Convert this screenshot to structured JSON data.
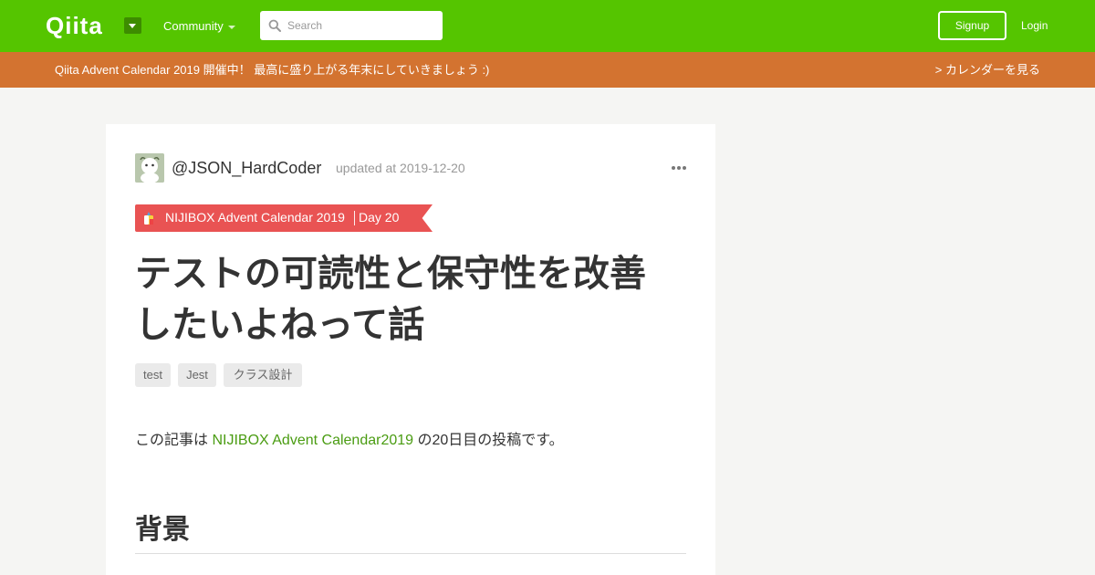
{
  "header": {
    "logo": "Qiita",
    "community_label": "Community",
    "search_placeholder": "Search",
    "signup_label": "Signup",
    "login_label": "Login"
  },
  "banner": {
    "text": "Qiita Advent Calendar 2019 開催中！ 最高に盛り上がる年末にしていきましょう :)",
    "link": "> カレンダーを見る"
  },
  "article": {
    "author": "@JSON_HardCoder",
    "updated": "updated at 2019-12-20",
    "calendar_name": "NIJIBOX Advent Calendar 2019",
    "calendar_day": "Day 20",
    "title_line1": "テストの可読性と保守性を改善",
    "title_line2": "したいよねって話",
    "tags": [
      "test",
      "Jest",
      "クラス設計"
    ],
    "intro_prefix": "この記事は ",
    "intro_link": "NIJIBOX Advent Calendar2019",
    "intro_suffix": " の20日目の投稿です。",
    "section_heading": "背景"
  },
  "colors": {
    "header_bg": "#55c500",
    "banner_bg": "#d37330",
    "ribbon_bg": "#e95353",
    "link": "#4a9c12"
  }
}
